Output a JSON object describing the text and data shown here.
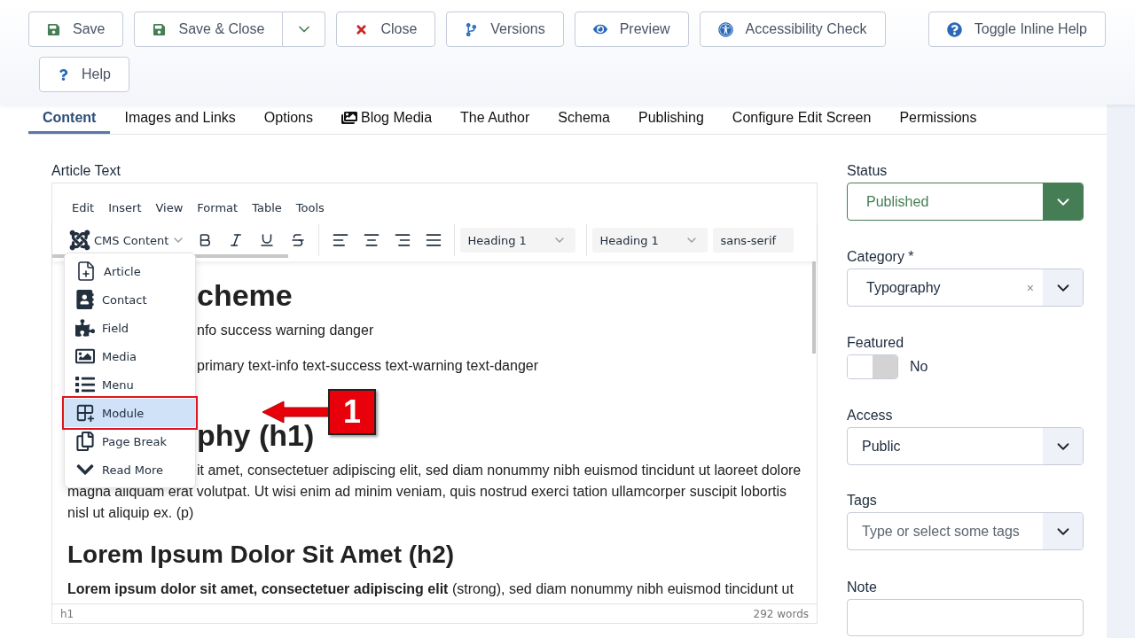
{
  "toolbar": {
    "buttons": [
      {
        "kind": "save",
        "label": "Save"
      },
      {
        "kind": "save-split",
        "label": "Save & Close"
      },
      {
        "kind": "close",
        "label": "Close"
      },
      {
        "kind": "versions",
        "label": "Versions"
      },
      {
        "kind": "preview",
        "label": "Preview"
      },
      {
        "kind": "accessibility",
        "label": "Accessibility Check"
      },
      {
        "kind": "inline-help",
        "label": "Toggle Inline Help"
      },
      {
        "kind": "help",
        "label": "Help"
      }
    ]
  },
  "tabs": [
    {
      "label": "Content",
      "kind": "text",
      "selected": true
    },
    {
      "label": "Images and Links",
      "kind": "text",
      "selected": false
    },
    {
      "label": "Options",
      "kind": "text",
      "selected": false
    },
    {
      "label": "Blog Media",
      "kind": "media",
      "selected": false
    },
    {
      "label": "The Author",
      "kind": "text",
      "selected": false
    },
    {
      "label": "Schema",
      "kind": "text",
      "selected": false
    },
    {
      "label": "Publishing",
      "kind": "text",
      "selected": false
    },
    {
      "label": "Configure Edit Screen",
      "kind": "text",
      "selected": false
    },
    {
      "label": "Permissions",
      "kind": "text",
      "selected": false
    }
  ],
  "editor": {
    "label": "Article Text",
    "menubar": [
      "Edit",
      "Insert",
      "View",
      "Format",
      "Table",
      "Tools"
    ],
    "cms_button": {
      "label": "CMS Content",
      "expanded": true
    },
    "selects": [
      "Heading 1",
      "Heading 1",
      "sans-serif"
    ],
    "menu": [
      {
        "kind": "article",
        "label": "Article",
        "selected": false,
        "marked": false
      },
      {
        "kind": "contact",
        "label": "Contact",
        "selected": false,
        "marked": false
      },
      {
        "kind": "field",
        "label": "Field",
        "selected": false,
        "marked": false
      },
      {
        "kind": "media",
        "label": "Media",
        "selected": false,
        "marked": false
      },
      {
        "kind": "menu",
        "label": "Menu",
        "selected": false,
        "marked": false
      },
      {
        "kind": "module",
        "label": "Module",
        "selected": true,
        "marked": true
      },
      {
        "kind": "pagebreak",
        "label": "Page Break",
        "selected": false,
        "marked": false
      },
      {
        "kind": "readmore",
        "label": "Read More",
        "selected": false,
        "marked": false
      }
    ],
    "content": [
      {
        "kind": "h1",
        "covered": true,
        "text": "cheme"
      },
      {
        "kind": "p",
        "covered": true,
        "text": "nfo success warning danger"
      },
      {
        "kind": "p",
        "covered": true,
        "text": "primary text-info text-success text-warning text-danger"
      },
      {
        "kind": "gap"
      },
      {
        "kind": "h1",
        "covered": true,
        "text": "phy (h1)"
      },
      {
        "kind": "line",
        "covered": true,
        "text": "it amet, consectetuer adipiscing elit, sed diam nonummy nibh euismod tincidunt ut laoreet dolore"
      },
      {
        "kind": "line",
        "text": "magna aliquam erat volutpat. Ut wisi enim ad minim veniam, quis nostrud exerci tation ullamcorper suscipit lobortis"
      },
      {
        "kind": "line",
        "text": "nisl ut aliquip ex. (p)"
      },
      {
        "kind": "h2",
        "text": "Lorem Ipsum Dolor Sit Amet (h2)"
      },
      {
        "kind": "p",
        "text": "**Lorem ipsum dolor sit amet, consectetuer adipiscing elit** (strong), sed diam nonummy nibh euismod tincidunt ut"
      }
    ],
    "path": "h1",
    "word_count": "292 words"
  },
  "annotation": {
    "label": "1"
  },
  "sidebar": [
    {
      "kind": "status",
      "label": "Status",
      "value": "Published"
    },
    {
      "kind": "clearable",
      "label": "Category *",
      "value": "Typography",
      "clear": "×"
    },
    {
      "kind": "switch",
      "label": "Featured",
      "on": false,
      "state": "No"
    },
    {
      "kind": "select",
      "label": "Access",
      "value": "Public"
    },
    {
      "kind": "tags",
      "label": "Tags",
      "placeholder": "Type or select some tags"
    },
    {
      "kind": "text",
      "label": "Note"
    }
  ]
}
